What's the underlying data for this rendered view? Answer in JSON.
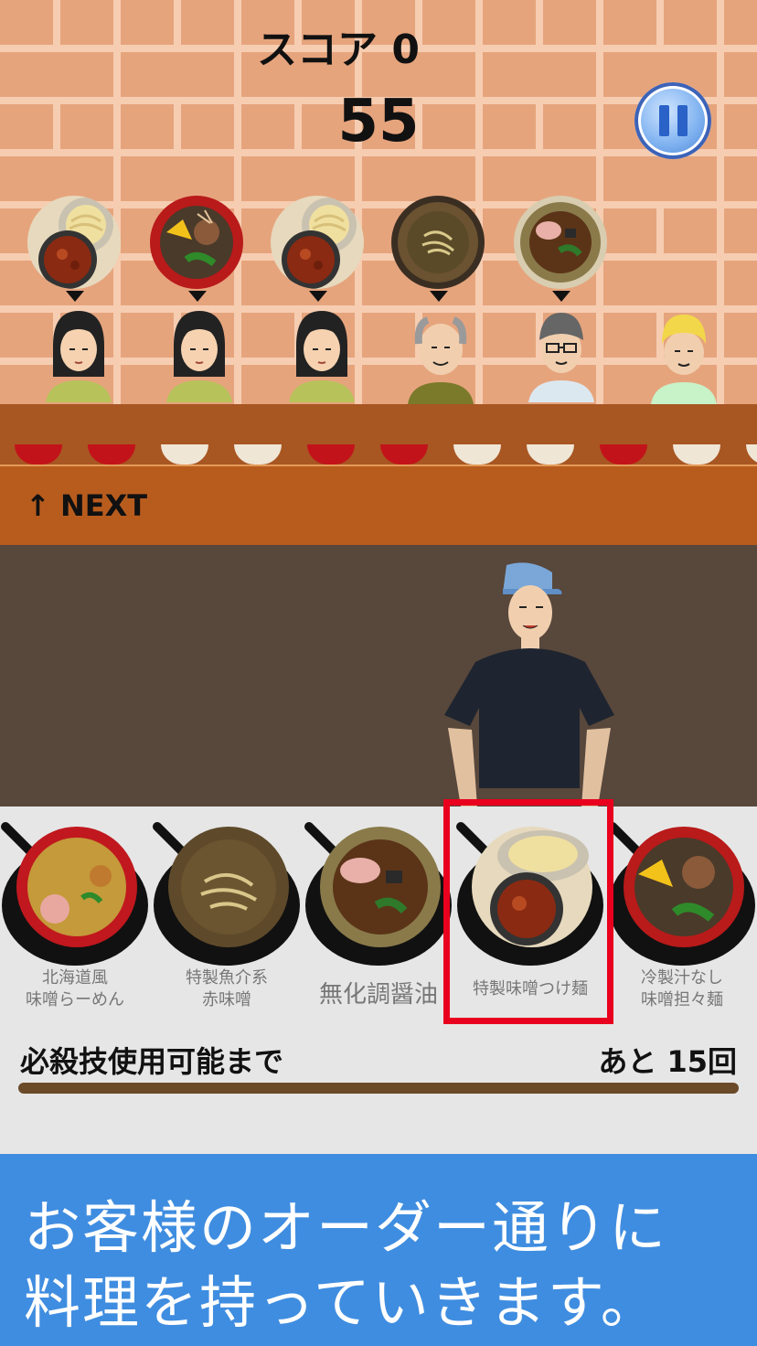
{
  "hud": {
    "score": "スコア 0",
    "timer": "55",
    "pause_icon": "pause-icon"
  },
  "customers": [
    {
      "order": "特製味噌つけ麺",
      "type": "woman"
    },
    {
      "order": "冷製汁なし味噌担々麺",
      "type": "woman"
    },
    {
      "order": "特製味噌つけ麺",
      "type": "woman"
    },
    {
      "order": "特製魚介系赤味噌",
      "type": "old-man"
    },
    {
      "order": "無化調醤油",
      "type": "glasses-man"
    },
    {
      "order": "",
      "type": "blond-boy"
    }
  ],
  "bowls": [
    "red",
    "red",
    "white",
    "white",
    "red",
    "red",
    "white",
    "white",
    "red",
    "white",
    "white"
  ],
  "next_label": "↑ NEXT",
  "dishes": [
    {
      "label": "北海道風\n味噌らーめん",
      "line1": "北海道風",
      "line2": "味噌らーめん"
    },
    {
      "label": "特製魚介系\n赤味噌",
      "line1": "特製魚介系",
      "line2": "赤味噌"
    },
    {
      "label": "無化調醤油",
      "line1": "無化調醤油",
      "line2": ""
    },
    {
      "label": "特製味噌つけ麺",
      "line1": "特製味噌つけ麺",
      "line2": ""
    },
    {
      "label": "冷製汁なし\n味噌担々麺",
      "line1": "冷製汁なし",
      "line2": "味噌担々麺"
    }
  ],
  "selected_dish_index": 3,
  "special": {
    "label": "必殺技使用可能まで",
    "remaining": "あと 15回"
  },
  "banner": {
    "line1": "お客様のオーダー通りに",
    "line2": "料理を持っていきます。"
  },
  "colors": {
    "highlight": "#e8001e",
    "banner": "#3f8de0",
    "counter": "#a85622"
  }
}
